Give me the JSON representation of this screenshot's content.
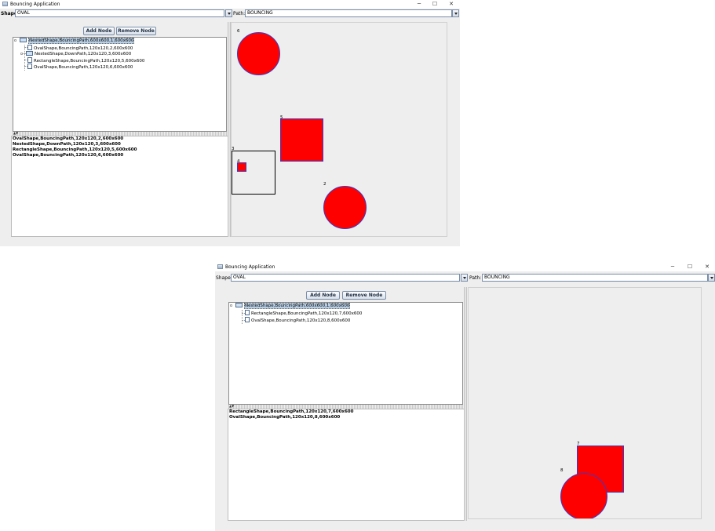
{
  "window1": {
    "title": "Bouncing Application",
    "controls": {
      "minimize": "─",
      "maximize": "☐",
      "close": "✕"
    },
    "shape_label": "Shape:",
    "shape_value": "OVAL",
    "path_label": "Path:",
    "path_value": "BOUNCING",
    "add_button": "Add Node",
    "remove_button": "Remove Node",
    "tree": [
      {
        "text": "NestedShape,BouncingPath,600x600,1,600x600",
        "selected": true
      },
      {
        "text": "OvalShape,BouncingPath,120x120,2,600x600"
      },
      {
        "text": "NestedShape,DownPath,120x120,3,600x600"
      },
      {
        "text": "RectangleShape,BouncingPath,120x120,5,600x600"
      },
      {
        "text": "OvalShape,BouncingPath,120x120,6,600x600"
      }
    ],
    "details": [
      "OvalShape,BouncingPath,120x120,2,600x600",
      "NestedShape,DownPath,120x120,3,600x600",
      "RectangleShape,BouncingPath,120x120,5,600x600",
      "OvalShape,BouncingPath,120x120,6,600x600"
    ],
    "shape_numbers": [
      "6",
      "5",
      "3",
      "4",
      "2"
    ]
  },
  "window2": {
    "title": "Bouncing Application",
    "controls": {
      "minimize": "─",
      "maximize": "☐",
      "close": "✕"
    },
    "shape_label": "Shape:",
    "shape_value": "OVAL",
    "path_label": "Path:",
    "path_value": "BOUNCING",
    "add_button": "Add Node",
    "remove_button": "Remove Node",
    "tree": [
      {
        "text": "NestedShape,BouncingPath,600x600,1,600x600",
        "selected": true
      },
      {
        "text": "RectangleShape,BouncingPath,120x120,7,600x600"
      },
      {
        "text": "OvalShape,BouncingPath,120x120,8,600x600"
      }
    ],
    "details": [
      "RectangleShape,BouncingPath,120x120,7,600x600",
      "OvalShape,BouncingPath,120x120,8,600x600"
    ],
    "shape_numbers": [
      "7",
      "8"
    ]
  },
  "colors": {
    "shape_fill": "#ff0000",
    "shape_border": "#3a3ac8",
    "selection": "#b8cfe5"
  }
}
